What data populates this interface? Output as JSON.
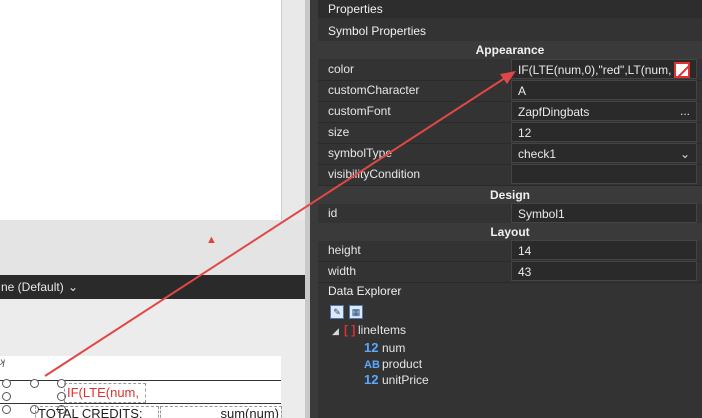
{
  "designer": {
    "toolbar_label": "ne (Default)",
    "expression_text": "IF(LTE(num,",
    "total_text": "TOTAL CREDITS:",
    "sum_text": "sum(num)"
  },
  "properties": {
    "title": "Properties",
    "subtitle": "Symbol Properties",
    "sections": {
      "appearance": "Appearance",
      "design": "Design",
      "layout": "Layout"
    },
    "color": {
      "label": "color",
      "value": "IF(LTE(num,0),\"red\",LT(num,"
    },
    "customCharacter": {
      "label": "customCharacter",
      "value": "A"
    },
    "customFont": {
      "label": "customFont",
      "value": "ZapfDingbats",
      "button": "..."
    },
    "size": {
      "label": "size",
      "value": "12"
    },
    "symbolType": {
      "label": "symbolType",
      "value": "check1"
    },
    "visibilityCondition": {
      "label": "visibilityCondition",
      "value": ""
    },
    "id": {
      "label": "id",
      "value": "Symbol1"
    },
    "height": {
      "label": "height",
      "value": "14"
    },
    "width": {
      "label": "width",
      "value": "43"
    }
  },
  "data_explorer": {
    "title": "Data Explorer",
    "root": {
      "label": "lineItems",
      "glyph": "[ ]"
    },
    "fields": [
      {
        "label": "num",
        "type_glyph": "12"
      },
      {
        "label": "product",
        "type_glyph": "AB"
      },
      {
        "label": "unitPrice",
        "type_glyph": "12"
      }
    ]
  },
  "colors": {
    "accent_red": "#e03030",
    "type_blue": "#5aa9ff",
    "panel_bg": "#333333"
  }
}
